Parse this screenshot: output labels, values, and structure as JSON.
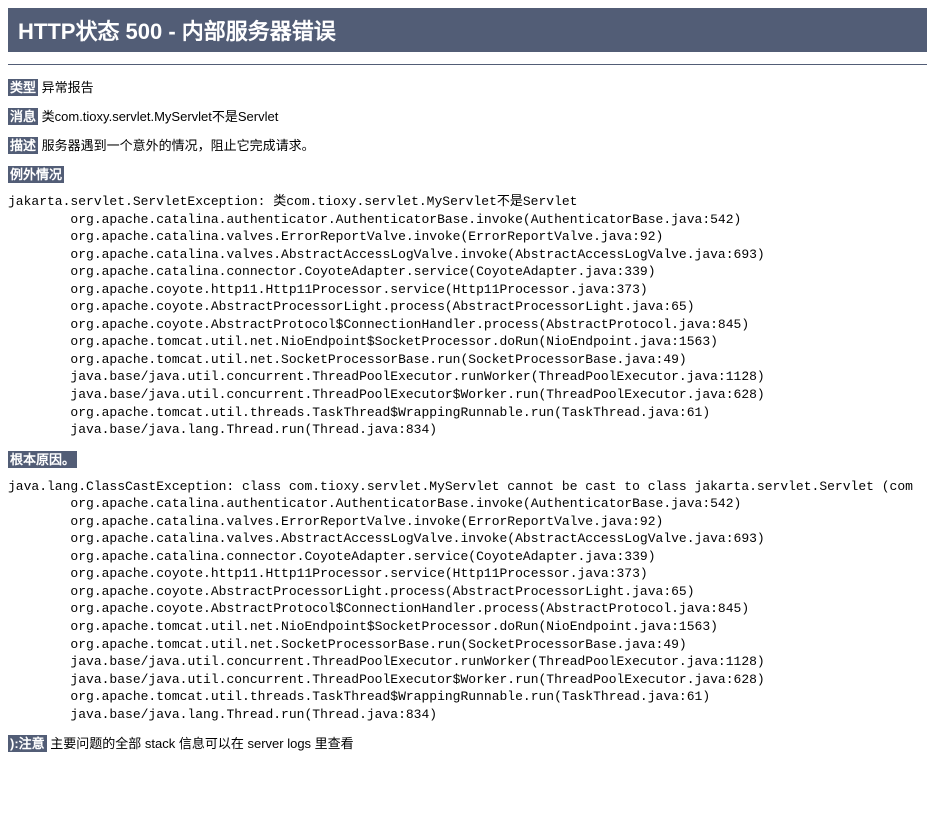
{
  "title": "HTTP状态 500 - 内部服务器错误",
  "fields": {
    "type_label": "类型",
    "type_value": "异常报告",
    "message_label": "消息",
    "message_value": "类com.tioxy.servlet.MyServlet不是Servlet",
    "description_label": "描述",
    "description_value": "服务器遇到一个意外的情况，阻止它完成请求。",
    "exception_label": "例外情况",
    "rootcause_label": "根本原因。",
    "note_label": "):注意",
    "note_value": "主要问题的全部 stack 信息可以在 server logs 里查看"
  },
  "exception_pre": "jakarta.servlet.ServletException: 类com.tioxy.servlet.MyServlet不是Servlet\n\torg.apache.catalina.authenticator.AuthenticatorBase.invoke(AuthenticatorBase.java:542)\n\torg.apache.catalina.valves.ErrorReportValve.invoke(ErrorReportValve.java:92)\n\torg.apache.catalina.valves.AbstractAccessLogValve.invoke(AbstractAccessLogValve.java:693)\n\torg.apache.catalina.connector.CoyoteAdapter.service(CoyoteAdapter.java:339)\n\torg.apache.coyote.http11.Http11Processor.service(Http11Processor.java:373)\n\torg.apache.coyote.AbstractProcessorLight.process(AbstractProcessorLight.java:65)\n\torg.apache.coyote.AbstractProtocol$ConnectionHandler.process(AbstractProtocol.java:845)\n\torg.apache.tomcat.util.net.NioEndpoint$SocketProcessor.doRun(NioEndpoint.java:1563)\n\torg.apache.tomcat.util.net.SocketProcessorBase.run(SocketProcessorBase.java:49)\n\tjava.base/java.util.concurrent.ThreadPoolExecutor.runWorker(ThreadPoolExecutor.java:1128)\n\tjava.base/java.util.concurrent.ThreadPoolExecutor$Worker.run(ThreadPoolExecutor.java:628)\n\torg.apache.tomcat.util.threads.TaskThread$WrappingRunnable.run(TaskThread.java:61)\n\tjava.base/java.lang.Thread.run(Thread.java:834)\n",
  "rootcause_pre": "java.lang.ClassCastException: class com.tioxy.servlet.MyServlet cannot be cast to class jakarta.servlet.Servlet (com\n\torg.apache.catalina.authenticator.AuthenticatorBase.invoke(AuthenticatorBase.java:542)\n\torg.apache.catalina.valves.ErrorReportValve.invoke(ErrorReportValve.java:92)\n\torg.apache.catalina.valves.AbstractAccessLogValve.invoke(AbstractAccessLogValve.java:693)\n\torg.apache.catalina.connector.CoyoteAdapter.service(CoyoteAdapter.java:339)\n\torg.apache.coyote.http11.Http11Processor.service(Http11Processor.java:373)\n\torg.apache.coyote.AbstractProcessorLight.process(AbstractProcessorLight.java:65)\n\torg.apache.coyote.AbstractProtocol$ConnectionHandler.process(AbstractProtocol.java:845)\n\torg.apache.tomcat.util.net.NioEndpoint$SocketProcessor.doRun(NioEndpoint.java:1563)\n\torg.apache.tomcat.util.net.SocketProcessorBase.run(SocketProcessorBase.java:49)\n\tjava.base/java.util.concurrent.ThreadPoolExecutor.runWorker(ThreadPoolExecutor.java:1128)\n\tjava.base/java.util.concurrent.ThreadPoolExecutor$Worker.run(ThreadPoolExecutor.java:628)\n\torg.apache.tomcat.util.threads.TaskThread$WrappingRunnable.run(TaskThread.java:61)\n\tjava.base/java.lang.Thread.run(Thread.java:834)\n"
}
